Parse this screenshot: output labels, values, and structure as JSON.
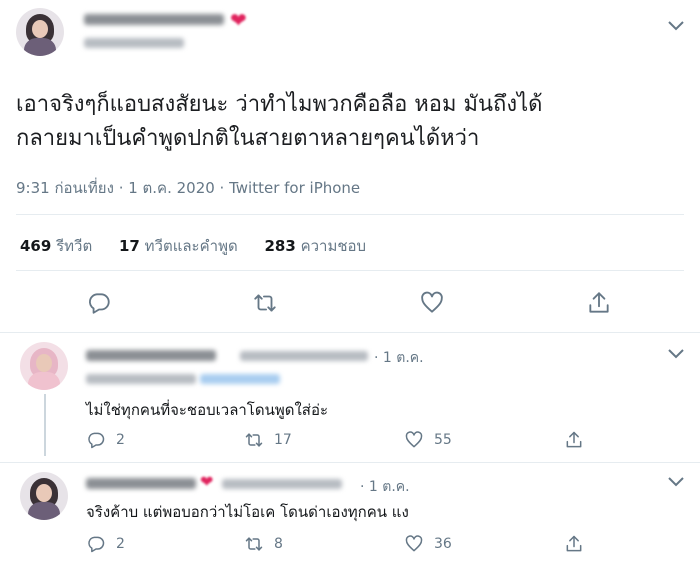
{
  "tweet": {
    "text_line1": "เอาจริงๆก็แอบสงสัยนะ ว่าทำไมพวกคือลือ หอม มันถึงได้",
    "text_line2": "กลายมาเป็นคำพูดปกติในสายตาหลายๆคนได้หว่า",
    "timestamp": "9:31 ก่อนเที่ยง · 1 ต.ค. 2020 · Twitter for iPhone",
    "retweets": {
      "count": "469",
      "label": "รีทวีต"
    },
    "quotes": {
      "count": "17",
      "label": "ทวีตและคำพูด"
    },
    "likes": {
      "count": "283",
      "label": "ความชอบ"
    }
  },
  "replies": [
    {
      "date": "· 1 ต.ค.",
      "text": "ไม่ใช่ทุกคนที่จะชอบเวลาโดนพูดใส่อ่ะ",
      "reply_count": "2",
      "retweet_count": "17",
      "like_count": "55"
    },
    {
      "date": "· 1 ต.ค.",
      "text": "จริงค้าบ แต่พอบอกว่าไม่โอเค โดนด่าเองทุกคน แง",
      "reply_count": "2",
      "retweet_count": "8",
      "like_count": "36"
    }
  ],
  "icons": {
    "reply": "reply-icon",
    "retweet": "retweet-icon",
    "like": "heart-icon",
    "share": "share-icon",
    "more": "chevron-down-icon"
  },
  "colors": {
    "muted": "#657786",
    "divider": "#e6ecf0",
    "heart": "#e0245e"
  }
}
